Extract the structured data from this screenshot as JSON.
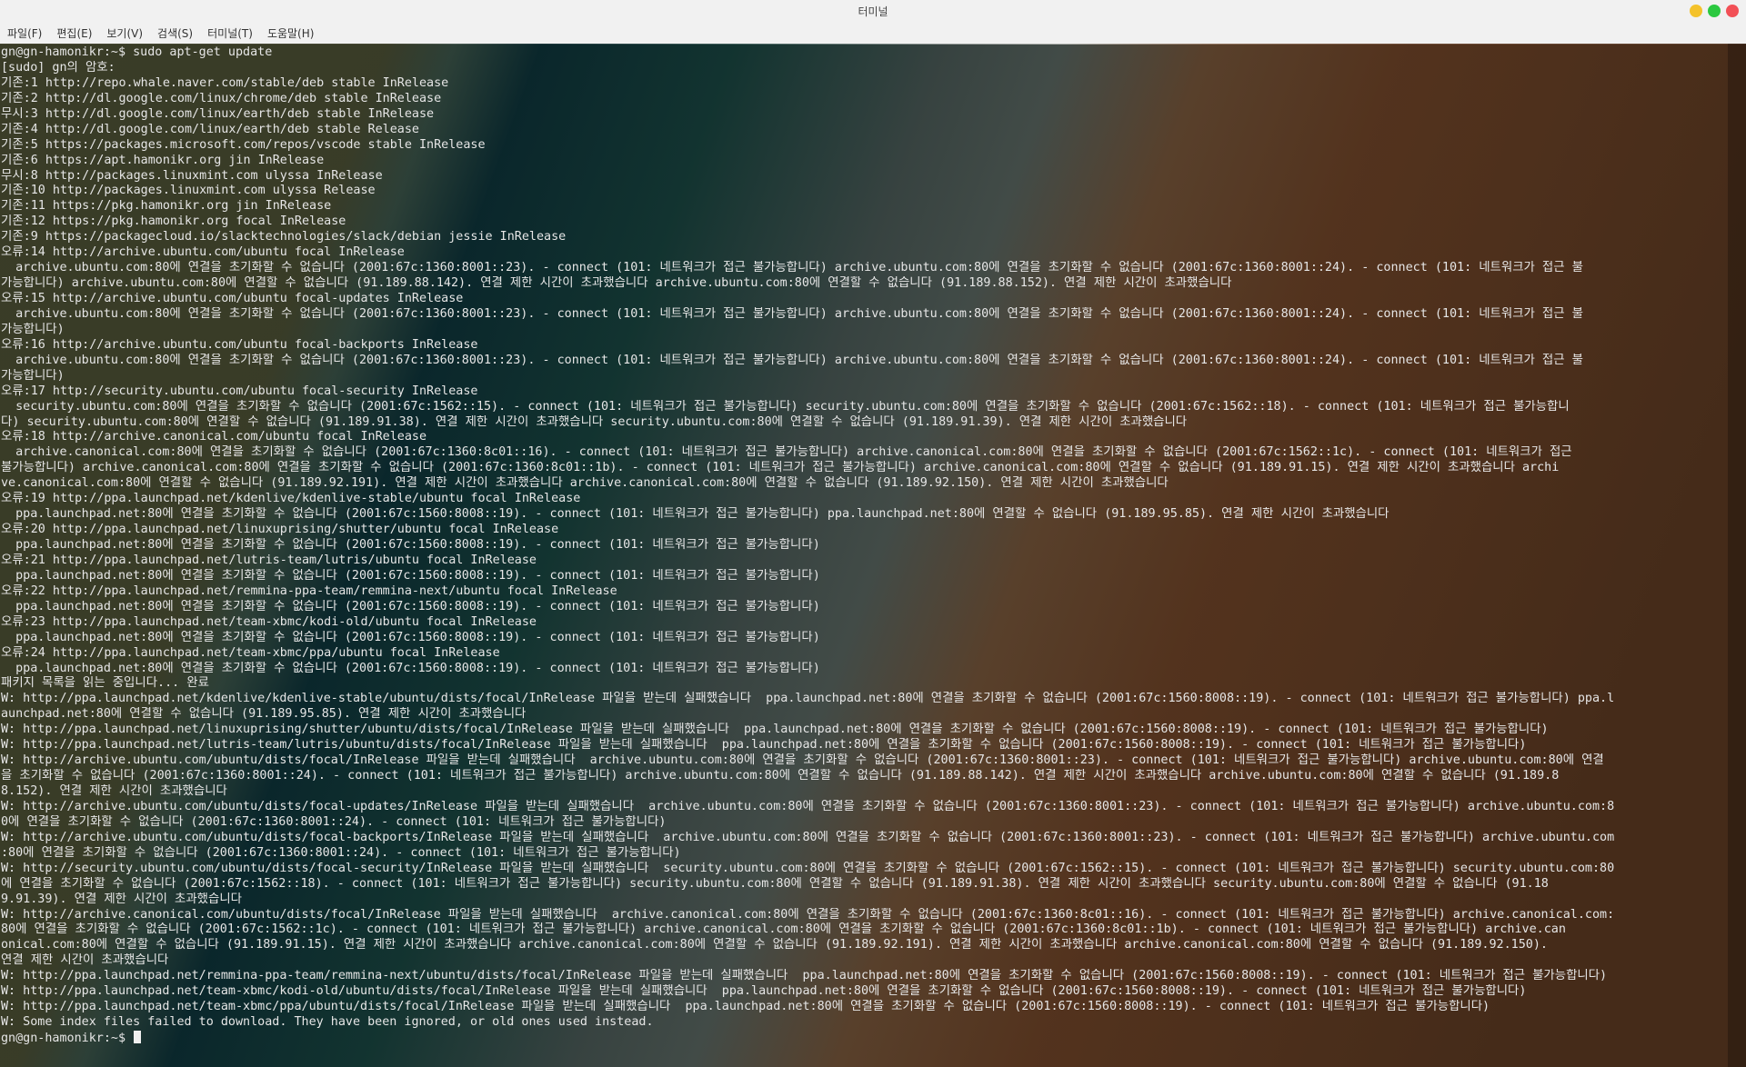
{
  "window": {
    "title": "터미널"
  },
  "menu": [
    "파일(F)",
    "편집(E)",
    "보기(V)",
    "검색(S)",
    "터미널(T)",
    "도움말(H)"
  ],
  "terminal": {
    "lines": [
      "gn@gn-hamonikr:~$ sudo apt-get update",
      "[sudo] gn의 암호:",
      "기존:1 http://repo.whale.naver.com/stable/deb stable InRelease",
      "기존:2 http://dl.google.com/linux/chrome/deb stable InRelease",
      "무시:3 http://dl.google.com/linux/earth/deb stable InRelease",
      "기존:4 http://dl.google.com/linux/earth/deb stable Release",
      "기존:5 https://packages.microsoft.com/repos/vscode stable InRelease",
      "기존:6 https://apt.hamonikr.org jin InRelease",
      "무시:8 http://packages.linuxmint.com ulyssa InRelease",
      "기존:10 http://packages.linuxmint.com ulyssa Release",
      "기존:11 https://pkg.hamonikr.org jin InRelease",
      "기존:12 https://pkg.hamonikr.org focal InRelease",
      "기존:9 https://packagecloud.io/slacktechnologies/slack/debian jessie InRelease",
      "오류:14 http://archive.ubuntu.com/ubuntu focal InRelease",
      "  archive.ubuntu.com:80에 연결을 초기화할 수 없습니다 (2001:67c:1360:8001::23). - connect (101: 네트워크가 접근 불가능합니다) archive.ubuntu.com:80에 연결을 초기화할 수 없습니다 (2001:67c:1360:8001::24). - connect (101: 네트워크가 접근 불",
      "가능합니다) archive.ubuntu.com:80에 연결할 수 없습니다 (91.189.88.142). 연결 제한 시간이 초과했습니다 archive.ubuntu.com:80에 연결할 수 없습니다 (91.189.88.152). 연결 제한 시간이 초과했습니다",
      "오류:15 http://archive.ubuntu.com/ubuntu focal-updates InRelease",
      "  archive.ubuntu.com:80에 연결을 초기화할 수 없습니다 (2001:67c:1360:8001::23). - connect (101: 네트워크가 접근 불가능합니다) archive.ubuntu.com:80에 연결을 초기화할 수 없습니다 (2001:67c:1360:8001::24). - connect (101: 네트워크가 접근 불",
      "가능합니다)",
      "오류:16 http://archive.ubuntu.com/ubuntu focal-backports InRelease",
      "  archive.ubuntu.com:80에 연결을 초기화할 수 없습니다 (2001:67c:1360:8001::23). - connect (101: 네트워크가 접근 불가능합니다) archive.ubuntu.com:80에 연결을 초기화할 수 없습니다 (2001:67c:1360:8001::24). - connect (101: 네트워크가 접근 불",
      "가능합니다)",
      "오류:17 http://security.ubuntu.com/ubuntu focal-security InRelease",
      "  security.ubuntu.com:80에 연결을 초기화할 수 없습니다 (2001:67c:1562::15). - connect (101: 네트워크가 접근 불가능합니다) security.ubuntu.com:80에 연결을 초기화할 수 없습니다 (2001:67c:1562::18). - connect (101: 네트워크가 접근 불가능합니",
      "다) security.ubuntu.com:80에 연결할 수 없습니다 (91.189.91.38). 연결 제한 시간이 초과했습니다 security.ubuntu.com:80에 연결할 수 없습니다 (91.189.91.39). 연결 제한 시간이 초과했습니다",
      "오류:18 http://archive.canonical.com/ubuntu focal InRelease",
      "  archive.canonical.com:80에 연결을 초기화할 수 없습니다 (2001:67c:1360:8c01::16). - connect (101: 네트워크가 접근 불가능합니다) archive.canonical.com:80에 연결을 초기화할 수 없습니다 (2001:67c:1562::1c). - connect (101: 네트워크가 접근",
      "불가능합니다) archive.canonical.com:80에 연결을 초기화할 수 없습니다 (2001:67c:1360:8c01::1b). - connect (101: 네트워크가 접근 불가능합니다) archive.canonical.com:80에 연결할 수 없습니다 (91.189.91.15). 연결 제한 시간이 초과했습니다 archi",
      "ve.canonical.com:80에 연결할 수 없습니다 (91.189.92.191). 연결 제한 시간이 초과했습니다 archive.canonical.com:80에 연결할 수 없습니다 (91.189.92.150). 연결 제한 시간이 초과했습니다",
      "오류:19 http://ppa.launchpad.net/kdenlive/kdenlive-stable/ubuntu focal InRelease",
      "  ppa.launchpad.net:80에 연결을 초기화할 수 없습니다 (2001:67c:1560:8008::19). - connect (101: 네트워크가 접근 불가능합니다) ppa.launchpad.net:80에 연결할 수 없습니다 (91.189.95.85). 연결 제한 시간이 초과했습니다",
      "오류:20 http://ppa.launchpad.net/linuxuprising/shutter/ubuntu focal InRelease",
      "  ppa.launchpad.net:80에 연결을 초기화할 수 없습니다 (2001:67c:1560:8008::19). - connect (101: 네트워크가 접근 불가능합니다)",
      "오류:21 http://ppa.launchpad.net/lutris-team/lutris/ubuntu focal InRelease",
      "  ppa.launchpad.net:80에 연결을 초기화할 수 없습니다 (2001:67c:1560:8008::19). - connect (101: 네트워크가 접근 불가능합니다)",
      "오류:22 http://ppa.launchpad.net/remmina-ppa-team/remmina-next/ubuntu focal InRelease",
      "  ppa.launchpad.net:80에 연결을 초기화할 수 없습니다 (2001:67c:1560:8008::19). - connect (101: 네트워크가 접근 불가능합니다)",
      "오류:23 http://ppa.launchpad.net/team-xbmc/kodi-old/ubuntu focal InRelease",
      "  ppa.launchpad.net:80에 연결을 초기화할 수 없습니다 (2001:67c:1560:8008::19). - connect (101: 네트워크가 접근 불가능합니다)",
      "오류:24 http://ppa.launchpad.net/team-xbmc/ppa/ubuntu focal InRelease",
      "  ppa.launchpad.net:80에 연결을 초기화할 수 없습니다 (2001:67c:1560:8008::19). - connect (101: 네트워크가 접근 불가능합니다)",
      "패키지 목록을 읽는 중입니다... 완료",
      "W: http://ppa.launchpad.net/kdenlive/kdenlive-stable/ubuntu/dists/focal/InRelease 파일을 받는데 실패했습니다  ppa.launchpad.net:80에 연결을 초기화할 수 없습니다 (2001:67c:1560:8008::19). - connect (101: 네트워크가 접근 불가능합니다) ppa.l",
      "aunchpad.net:80에 연결할 수 없습니다 (91.189.95.85). 연결 제한 시간이 초과했습니다",
      "W: http://ppa.launchpad.net/linuxuprising/shutter/ubuntu/dists/focal/InRelease 파일을 받는데 실패했습니다  ppa.launchpad.net:80에 연결을 초기화할 수 없습니다 (2001:67c:1560:8008::19). - connect (101: 네트워크가 접근 불가능합니다)",
      "W: http://ppa.launchpad.net/lutris-team/lutris/ubuntu/dists/focal/InRelease 파일을 받는데 실패했습니다  ppa.launchpad.net:80에 연결을 초기화할 수 없습니다 (2001:67c:1560:8008::19). - connect (101: 네트워크가 접근 불가능합니다)",
      "W: http://archive.ubuntu.com/ubuntu/dists/focal/InRelease 파일을 받는데 실패했습니다  archive.ubuntu.com:80에 연결을 초기화할 수 없습니다 (2001:67c:1360:8001::23). - connect (101: 네트워크가 접근 불가능합니다) archive.ubuntu.com:80에 연결",
      "을 초기화할 수 없습니다 (2001:67c:1360:8001::24). - connect (101: 네트워크가 접근 불가능합니다) archive.ubuntu.com:80에 연결할 수 없습니다 (91.189.88.142). 연결 제한 시간이 초과했습니다 archive.ubuntu.com:80에 연결할 수 없습니다 (91.189.8",
      "8.152). 연결 제한 시간이 초과했습니다",
      "W: http://archive.ubuntu.com/ubuntu/dists/focal-updates/InRelease 파일을 받는데 실패했습니다  archive.ubuntu.com:80에 연결을 초기화할 수 없습니다 (2001:67c:1360:8001::23). - connect (101: 네트워크가 접근 불가능합니다) archive.ubuntu.com:8",
      "0에 연결을 초기화할 수 없습니다 (2001:67c:1360:8001::24). - connect (101: 네트워크가 접근 불가능합니다)",
      "W: http://archive.ubuntu.com/ubuntu/dists/focal-backports/InRelease 파일을 받는데 실패했습니다  archive.ubuntu.com:80에 연결을 초기화할 수 없습니다 (2001:67c:1360:8001::23). - connect (101: 네트워크가 접근 불가능합니다) archive.ubuntu.com",
      ":80에 연결을 초기화할 수 없습니다 (2001:67c:1360:8001::24). - connect (101: 네트워크가 접근 불가능합니다)",
      "W: http://security.ubuntu.com/ubuntu/dists/focal-security/InRelease 파일을 받는데 실패했습니다  security.ubuntu.com:80에 연결을 초기화할 수 없습니다 (2001:67c:1562::15). - connect (101: 네트워크가 접근 불가능합니다) security.ubuntu.com:80",
      "에 연결을 초기화할 수 없습니다 (2001:67c:1562::18). - connect (101: 네트워크가 접근 불가능합니다) security.ubuntu.com:80에 연결할 수 없습니다 (91.189.91.38). 연결 제한 시간이 초과했습니다 security.ubuntu.com:80에 연결할 수 없습니다 (91.18",
      "9.91.39). 연결 제한 시간이 초과했습니다",
      "W: http://archive.canonical.com/ubuntu/dists/focal/InRelease 파일을 받는데 실패했습니다  archive.canonical.com:80에 연결을 초기화할 수 없습니다 (2001:67c:1360:8c01::16). - connect (101: 네트워크가 접근 불가능합니다) archive.canonical.com:",
      "80에 연결을 초기화할 수 없습니다 (2001:67c:1562::1c). - connect (101: 네트워크가 접근 불가능합니다) archive.canonical.com:80에 연결을 초기화할 수 없습니다 (2001:67c:1360:8c01::1b). - connect (101: 네트워크가 접근 불가능합니다) archive.can",
      "onical.com:80에 연결할 수 없습니다 (91.189.91.15). 연결 제한 시간이 초과했습니다 archive.canonical.com:80에 연결할 수 없습니다 (91.189.92.191). 연결 제한 시간이 초과했습니다 archive.canonical.com:80에 연결할 수 없습니다 (91.189.92.150).",
      "연결 제한 시간이 초과했습니다",
      "W: http://ppa.launchpad.net/remmina-ppa-team/remmina-next/ubuntu/dists/focal/InRelease 파일을 받는데 실패했습니다  ppa.launchpad.net:80에 연결을 초기화할 수 없습니다 (2001:67c:1560:8008::19). - connect (101: 네트워크가 접근 불가능합니다)",
      "W: http://ppa.launchpad.net/team-xbmc/kodi-old/ubuntu/dists/focal/InRelease 파일을 받는데 실패했습니다  ppa.launchpad.net:80에 연결을 초기화할 수 없습니다 (2001:67c:1560:8008::19). - connect (101: 네트워크가 접근 불가능합니다)",
      "W: http://ppa.launchpad.net/team-xbmc/ppa/ubuntu/dists/focal/InRelease 파일을 받는데 실패했습니다  ppa.launchpad.net:80에 연결을 초기화할 수 없습니다 (2001:67c:1560:8008::19). - connect (101: 네트워크가 접근 불가능합니다)",
      "W: Some index files failed to download. They have been ignored, or old ones used instead."
    ],
    "prompt": "gn@gn-hamonikr:~$ "
  }
}
